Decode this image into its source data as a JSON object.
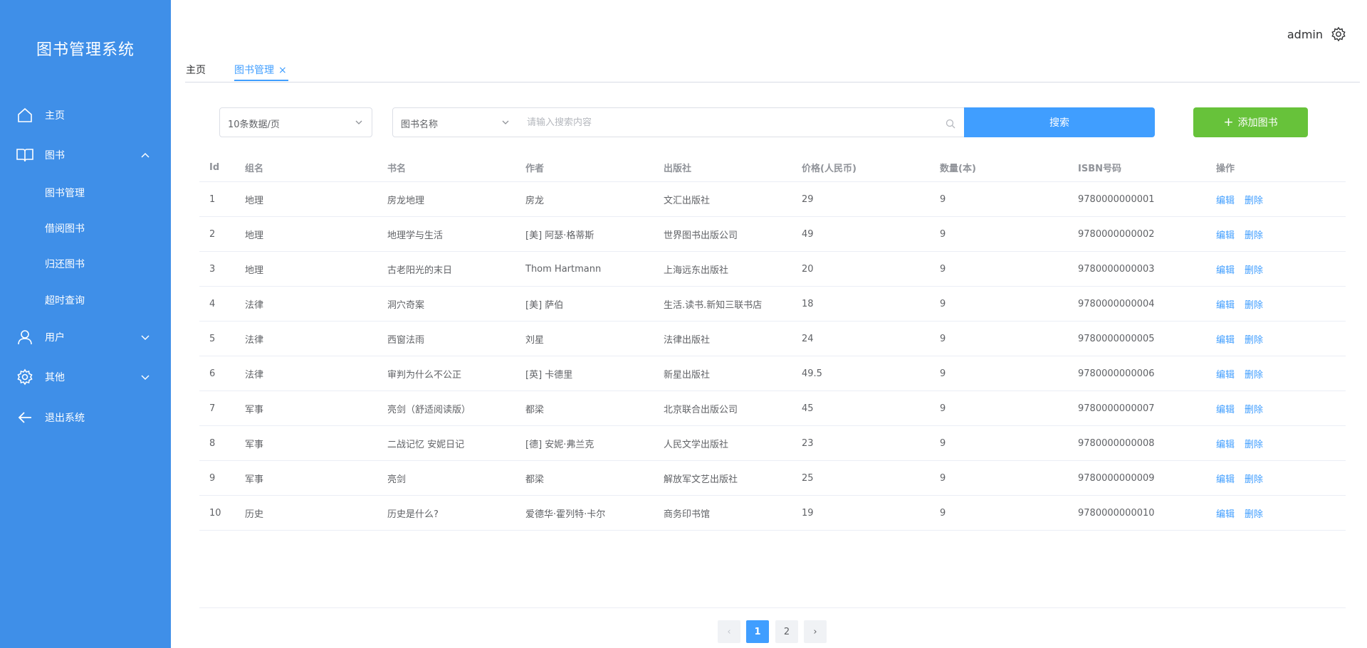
{
  "app": {
    "title": "图书管理系统"
  },
  "sidebar": {
    "home": "主页",
    "books": "图书",
    "books_children": [
      "图书管理",
      "借阅图书",
      "归还图书",
      "超时查询"
    ],
    "users": "用户",
    "other": "其他",
    "logout": "退出系统"
  },
  "header": {
    "username": "admin"
  },
  "tabs": {
    "home": "主页",
    "active": "图书管理",
    "close": "×"
  },
  "toolbar": {
    "page_size": "10条数据/页",
    "search_field": "图书名称",
    "search_placeholder": "请输入搜索内容",
    "search_button": "搜索",
    "add_button": "添加图书",
    "add_plus": "+"
  },
  "table": {
    "headers": [
      "Id",
      "组名",
      "书名",
      "作者",
      "出版社",
      "价格(人民币)",
      "数量(本)",
      "ISBN号码",
      "操作"
    ],
    "edit_label": "编辑",
    "delete_label": "删除",
    "rows": [
      [
        "1",
        "地理",
        "房龙地理",
        "房龙",
        "文汇出版社",
        "29",
        "9",
        "9780000000001"
      ],
      [
        "2",
        "地理",
        "地理学与生活",
        "[美] 阿瑟·格蒂斯",
        "世界图书出版公司",
        "49",
        "9",
        "9780000000002"
      ],
      [
        "3",
        "地理",
        "古老阳光的末日",
        "Thom Hartmann",
        "上海远东出版社",
        "20",
        "9",
        "9780000000003"
      ],
      [
        "4",
        "法律",
        "洞穴奇案",
        "[美] 萨伯",
        "生活.读书.新知三联书店",
        "18",
        "9",
        "9780000000004"
      ],
      [
        "5",
        "法律",
        "西窗法雨",
        "刘星",
        "法律出版社",
        "24",
        "9",
        "9780000000005"
      ],
      [
        "6",
        "法律",
        "审判为什么不公正",
        "[英] 卡德里",
        "新星出版社",
        "49.5",
        "9",
        "9780000000006"
      ],
      [
        "7",
        "军事",
        "亮剑（舒适阅读版）",
        "都梁",
        "北京联合出版公司",
        "45",
        "9",
        "9780000000007"
      ],
      [
        "8",
        "军事",
        "二战记忆 安妮日记",
        "[德] 安妮·弗兰克",
        "人民文学出版社",
        "23",
        "9",
        "9780000000008"
      ],
      [
        "9",
        "军事",
        "亮剑",
        "都梁",
        "解放军文艺出版社",
        "25",
        "9",
        "9780000000009"
      ],
      [
        "10",
        "历史",
        "历史是什么?",
        "爱德华·霍列特·卡尔",
        "商务印书馆",
        "19",
        "9",
        "9780000000010"
      ]
    ]
  },
  "pagination": {
    "prev": "‹",
    "pages": [
      "1",
      "2"
    ],
    "current": "1",
    "next": "›"
  }
}
